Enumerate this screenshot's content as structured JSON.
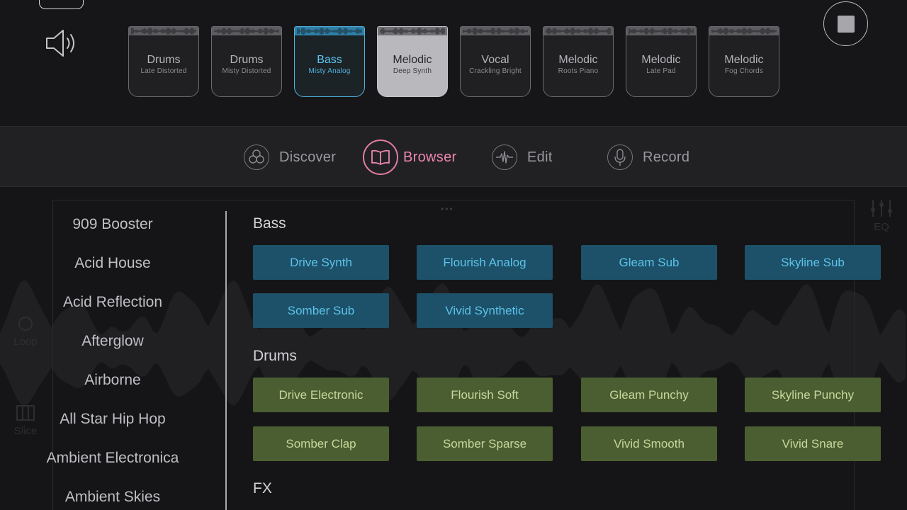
{
  "header": {
    "volume_icon": "speaker-icon",
    "stop_icon": "stop-icon"
  },
  "packs": [
    {
      "title": "Drums",
      "subtitle": "Late Distorted",
      "state": "normal"
    },
    {
      "title": "Drums",
      "subtitle": "Misty Distorted",
      "state": "normal"
    },
    {
      "title": "Bass",
      "subtitle": "Misty Analog",
      "state": "active"
    },
    {
      "title": "Melodic",
      "subtitle": "Deep Synth",
      "state": "selected"
    },
    {
      "title": "Vocal",
      "subtitle": "Crackling Bright",
      "state": "normal"
    },
    {
      "title": "Melodic",
      "subtitle": "Roots Piano",
      "state": "normal"
    },
    {
      "title": "Melodic",
      "subtitle": "Late Pad",
      "state": "normal"
    },
    {
      "title": "Melodic",
      "subtitle": "Fog Chords",
      "state": "normal"
    }
  ],
  "modes": [
    {
      "label": "Discover",
      "icon": "discover-icon",
      "active": false
    },
    {
      "label": "Browser",
      "icon": "book-icon",
      "active": true
    },
    {
      "label": "Edit",
      "icon": "waveform-icon",
      "active": false
    },
    {
      "label": "Record",
      "icon": "microphone-icon",
      "active": false
    }
  ],
  "side_tools": {
    "loop": "Loop",
    "slice": "Slice",
    "eq": "EQ"
  },
  "genres": [
    "909 Booster",
    "Acid House",
    "Acid Reflection",
    "Afterglow",
    "Airborne",
    "All Star Hip Hop",
    "Ambient Electronica",
    "Ambient Skies"
  ],
  "sections": {
    "bass": {
      "title": "Bass",
      "items": [
        "Drive Synth",
        "Flourish Analog",
        "Gleam Sub",
        "Skyline Sub",
        "Somber Sub",
        "Vivid Synthetic"
      ]
    },
    "drums": {
      "title": "Drums",
      "items": [
        "Drive Electronic",
        "Flourish Soft",
        "Gleam Punchy",
        "Skyline Punchy",
        "Somber Clap",
        "Somber Sparse",
        "Vivid Smooth",
        "Vivid Snare"
      ]
    },
    "fx": {
      "title": "FX"
    }
  },
  "colors": {
    "accent_pink": "#ee86ad",
    "bass_chip": "#1d5169",
    "bass_text": "#5cc3ea",
    "drums_chip": "#4b5e31",
    "drums_text": "#c6d89c",
    "active_pack": "#4fb2dc"
  }
}
